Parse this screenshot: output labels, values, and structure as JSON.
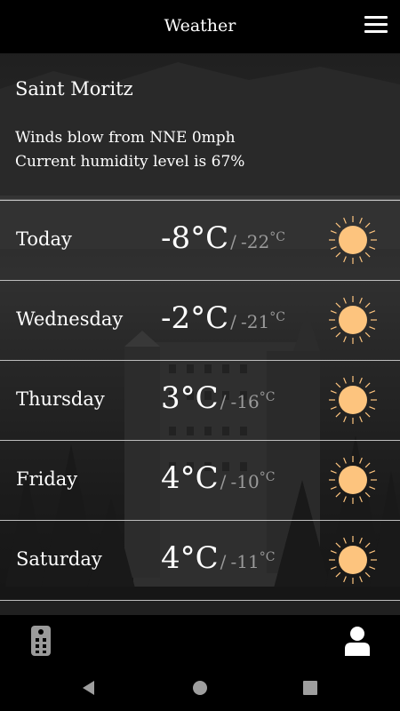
{
  "appbar": {
    "title": "Weather",
    "menu_icon": "hamburger-menu-icon"
  },
  "location": {
    "city": "Saint Moritz",
    "wind_text": "Winds blow from NNE 0mph",
    "humidity_text": "Current humidity level is 67%"
  },
  "forecast": [
    {
      "day": "Today",
      "high": "-8°C",
      "sep": "/",
      "low": "-22",
      "low_unit": "°C",
      "icon": "sun-icon"
    },
    {
      "day": "Wednesday",
      "high": "-2°C",
      "sep": "/",
      "low": "-21",
      "low_unit": "°C",
      "icon": "sun-icon"
    },
    {
      "day": "Thursday",
      "high": "3°C",
      "sep": "/",
      "low": "-16",
      "low_unit": "°C",
      "icon": "sun-icon"
    },
    {
      "day": "Friday",
      "high": "4°C",
      "sep": "/",
      "low": "-10",
      "low_unit": "°C",
      "icon": "sun-icon"
    },
    {
      "day": "Saturday",
      "high": "4°C",
      "sep": "/",
      "low": "-11",
      "low_unit": "°C",
      "icon": "sun-icon"
    }
  ],
  "bottomnav": {
    "left_icon": "remote-control-icon",
    "right_icon": "user-profile-icon"
  },
  "system_nav": {
    "back_icon": "back-triangle-icon",
    "home_icon": "home-circle-icon",
    "recent_icon": "recent-apps-square-icon"
  },
  "colors": {
    "sun": "#fdc47e",
    "text_primary": "#ffffff",
    "text_secondary": "#9a9a9a",
    "bar": "#000000"
  }
}
